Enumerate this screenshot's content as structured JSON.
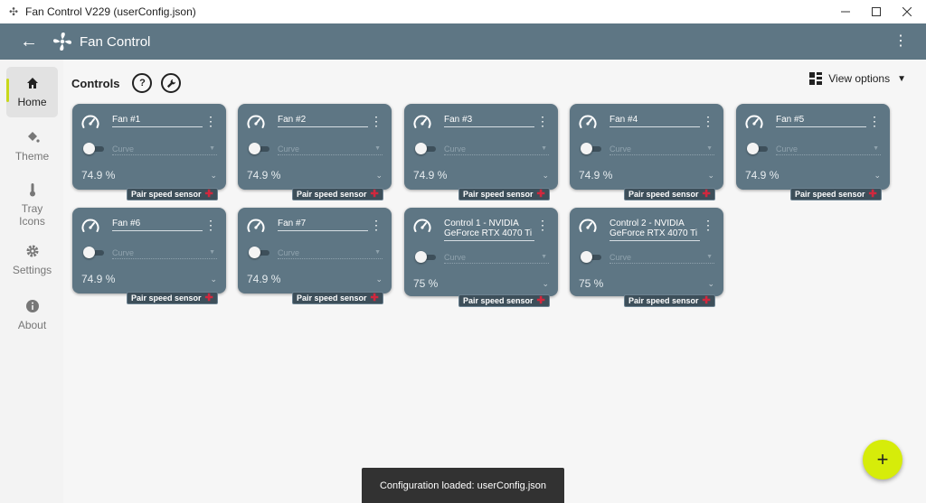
{
  "window": {
    "title": "Fan Control V229 (userConfig.json)",
    "minimize_icon": "minimize-icon",
    "maximize_icon": "maximize-icon",
    "close_icon": "close-icon"
  },
  "appbar": {
    "title": "Fan Control",
    "back_icon": "arrow-left-icon",
    "logo_icon": "fan-icon",
    "menu_icon": "more-vertical-icon"
  },
  "sidebar": {
    "items": [
      {
        "label": "Home",
        "icon": "home-icon",
        "active": true
      },
      {
        "label": "Theme",
        "icon": "paint-bucket-icon",
        "active": false
      },
      {
        "label": "Tray Icons",
        "icon": "thermometer-icon",
        "active": false
      },
      {
        "label": "Settings",
        "icon": "gear-icon",
        "active": false
      },
      {
        "label": "About",
        "icon": "info-icon",
        "active": false
      }
    ],
    "accent_color": "#c8d81a"
  },
  "main": {
    "header": "Controls",
    "help_icon": "question-icon",
    "tools_icon": "wrench-icon",
    "view_options": "View options"
  },
  "cards": [
    {
      "name": "Fan #1",
      "mode": "Curve",
      "value": "74.9 %",
      "pair_label": "Pair speed sensor"
    },
    {
      "name": "Fan #2",
      "mode": "Curve",
      "value": "74.9 %",
      "pair_label": "Pair speed sensor"
    },
    {
      "name": "Fan #3",
      "mode": "Curve",
      "value": "74.9 %",
      "pair_label": "Pair speed sensor"
    },
    {
      "name": "Fan #4",
      "mode": "Curve",
      "value": "74.9 %",
      "pair_label": "Pair speed sensor"
    },
    {
      "name": "Fan #5",
      "mode": "Curve",
      "value": "74.9 %",
      "pair_label": "Pair speed sensor"
    },
    {
      "name": "Fan #6",
      "mode": "Curve",
      "value": "74.9 %",
      "pair_label": "Pair speed sensor"
    },
    {
      "name": "Fan #7",
      "mode": "Curve",
      "value": "74.9 %",
      "pair_label": "Pair speed sensor"
    },
    {
      "name": "Control 1 - NVIDIA GeForce RTX 4070 Ti",
      "mode": "Curve",
      "value": "75 %",
      "pair_label": "Pair speed sensor"
    },
    {
      "name": "Control 2 - NVIDIA GeForce RTX 4070 Ti",
      "mode": "Curve",
      "value": "75 %",
      "pair_label": "Pair speed sensor"
    }
  ],
  "colors": {
    "card_bg": "#5e7684",
    "appbar_bg": "#5e7684",
    "fab_bg": "#d6ec0a",
    "pair_x": "#d0283e"
  },
  "fab": {
    "icon": "plus-icon",
    "label": "+"
  },
  "snackbar": {
    "text": "Configuration loaded: userConfig.json"
  }
}
